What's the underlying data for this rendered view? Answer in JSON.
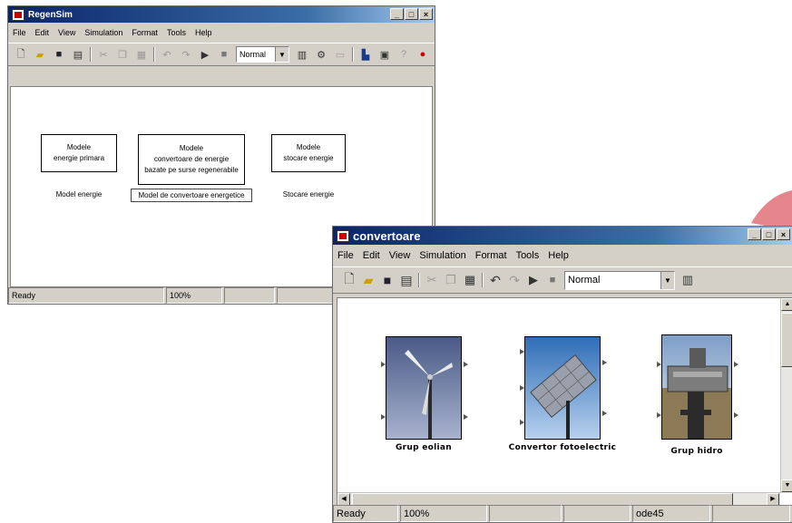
{
  "window1": {
    "title": "RegenSim",
    "menu": [
      "File",
      "Edit",
      "View",
      "Simulation",
      "Format",
      "Tools",
      "Help"
    ],
    "zoom_mode": "Normal",
    "blocks": [
      {
        "line1": "Modele",
        "line2": "energie primara",
        "line3": "",
        "label": "Model energie"
      },
      {
        "line1": "Modele",
        "line2": "convertoare de energie",
        "line3": "bazate pe surse regenerabile",
        "label": "Model de convertoare energetice"
      },
      {
        "line1": "Modele",
        "line2": "stocare energie",
        "line3": "",
        "label": "Stocare energie"
      }
    ],
    "status": {
      "state": "Ready",
      "zoom": "100%"
    }
  },
  "window2": {
    "title": "convertoare",
    "menu": [
      "File",
      "Edit",
      "View",
      "Simulation",
      "Format",
      "Tools",
      "Help"
    ],
    "zoom_mode": "Normal",
    "blocks": [
      {
        "label": "Grup eolian",
        "image": "wind-turbine"
      },
      {
        "label": "Convertor fotoelectric",
        "image": "solar-panel"
      },
      {
        "label": "Grup hidro",
        "image": "hydro-turbine"
      }
    ],
    "status": {
      "state": "Ready",
      "zoom": "100%",
      "solver": "ode45"
    }
  },
  "colors": {
    "titlebar_start": "#0a246a",
    "titlebar_end": "#a6caf0",
    "arrow": "#e07078"
  }
}
